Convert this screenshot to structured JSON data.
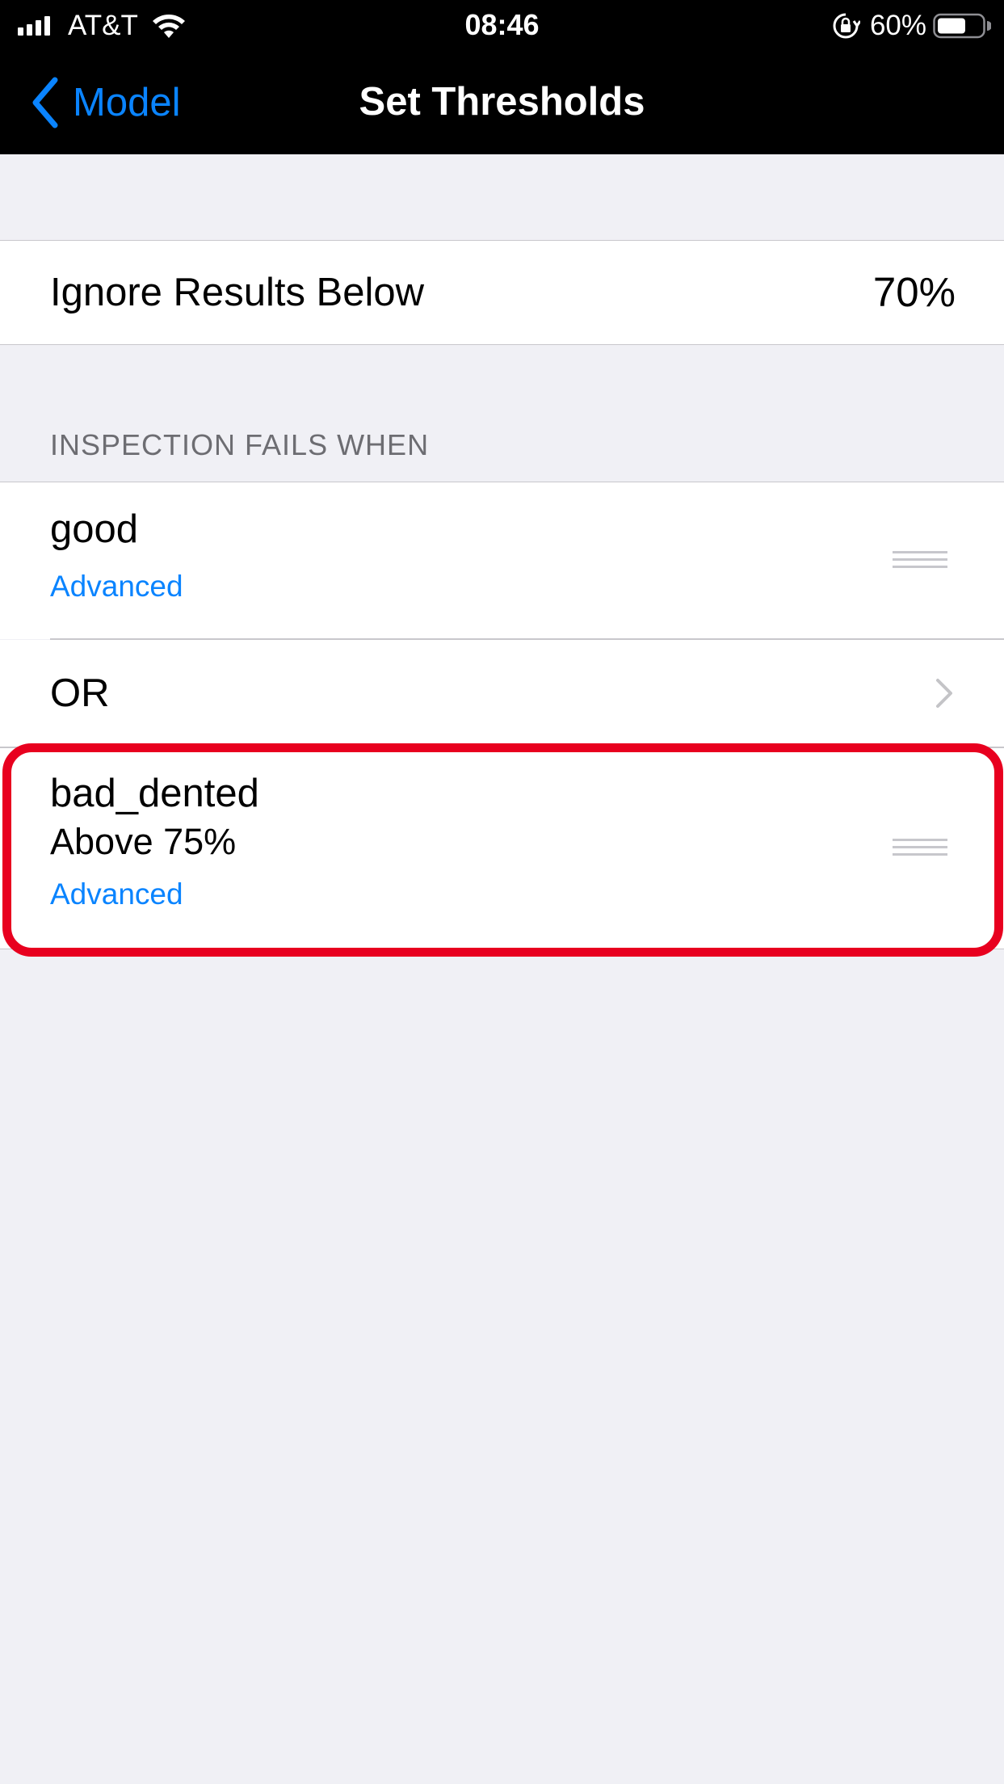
{
  "status_bar": {
    "carrier": "AT&T",
    "time": "08:46",
    "battery_percent": "60%",
    "icons": [
      "signal-icon",
      "wifi-icon",
      "orientation-lock-icon",
      "battery-icon"
    ]
  },
  "navbar": {
    "back_label": "Model",
    "title": "Set Thresholds"
  },
  "settings": {
    "ignore_label": "Ignore Results Below",
    "ignore_value": "70%"
  },
  "section": {
    "header": "INSPECTION FAILS WHEN"
  },
  "conditions": [
    {
      "label": "good",
      "advanced_label": "Advanced"
    },
    {
      "operator": "OR"
    },
    {
      "label": "bad_dented",
      "detail": "Above 75%",
      "advanced_label": "Advanced"
    }
  ],
  "colors": {
    "accent": "#0a84ff",
    "highlight": "#e8001f",
    "background": "#f0f0f5",
    "navbar": "#000000"
  }
}
